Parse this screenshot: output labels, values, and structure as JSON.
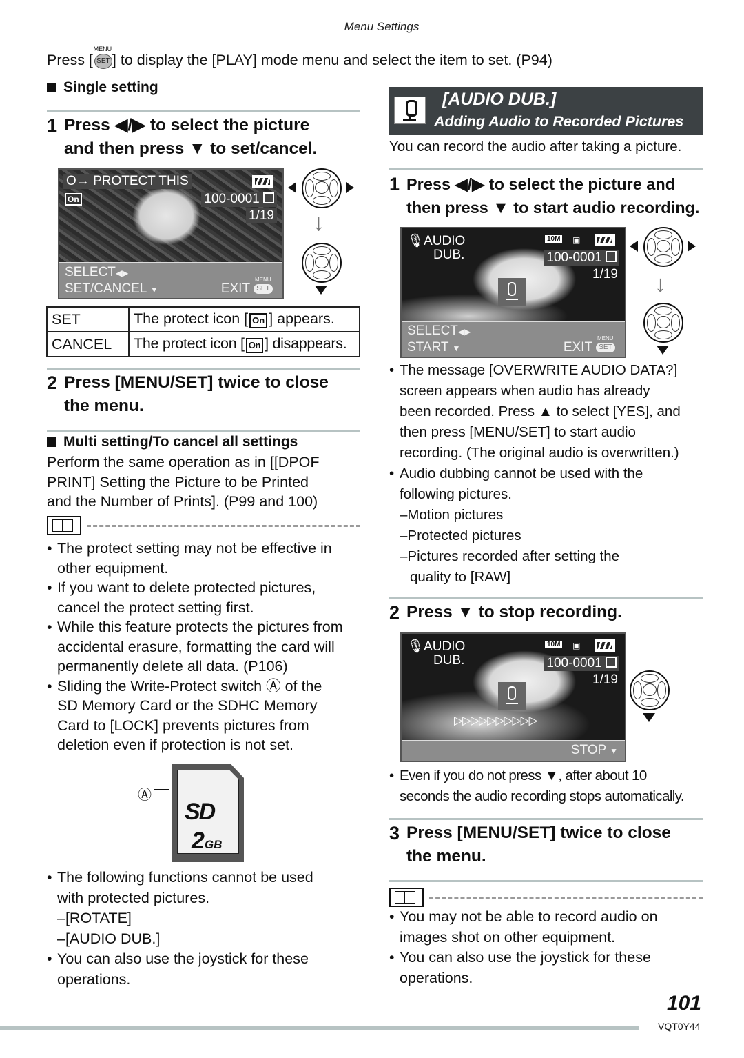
{
  "page": {
    "header": "Menu Settings",
    "page_number": "101",
    "doc_code": "VQT0Y44"
  },
  "intro": {
    "before": "Press [",
    "menu_icon_top": "MENU",
    "menu_icon_label": "SET",
    "after": "] to display the [PLAY] mode menu and select the item to set. (P94)"
  },
  "left": {
    "single_setting_heading": "Single setting",
    "step1": {
      "num": "1",
      "line1": "Press ◀/▶ to select the picture",
      "line2": "and then press ▼ to set/cancel."
    },
    "screen1": {
      "title": "PROTECT THIS",
      "file_no": "100-0001",
      "count": "1/19",
      "select": "SELECT",
      "set_cancel": "SET/CANCEL",
      "exit": "EXIT",
      "menu_small": "MENU",
      "set_small": "SET"
    },
    "table": [
      {
        "key": "SET",
        "before": "The protect icon [",
        "after": "] appears."
      },
      {
        "key": "CANCEL",
        "before": "The protect icon [",
        "after": "] disappears."
      }
    ],
    "protect_icon_glyph": "On",
    "step2": {
      "num": "2",
      "line1": "Press [MENU/SET] twice to close",
      "line2": "the menu."
    },
    "multi_heading": "Multi setting/To cancel all settings",
    "multi_lines": [
      "Perform the same operation as in [[DPOF",
      "PRINT] Setting the Picture to be Printed",
      "and the Number of Prints]. (P99 and 100)"
    ],
    "notes": [
      [
        "The protect setting may not be effective in",
        "other equipment."
      ],
      [
        "If you want to delete protected pictures,",
        "cancel the protect setting first."
      ],
      [
        "While this feature protects the pictures from",
        "accidental erasure, formatting the card will",
        "permanently delete all data. (P106)"
      ],
      [
        "Sliding the Write-Protect switch Ⓐ of the",
        "SD Memory Card or the SDHC Memory",
        "Card to [LOCK] prevents pictures from",
        "deletion even if protection is not set."
      ]
    ],
    "sd_card": {
      "marker": "Ⓐ",
      "logo": "SD",
      "capacity_num": "2",
      "capacity_unit": "GB"
    },
    "notes2": [
      [
        "The following functions cannot be used",
        "with protected pictures."
      ]
    ],
    "notes2_sub": [
      "–[ROTATE]",
      "–[AUDIO DUB.]"
    ],
    "notes3": [
      [
        "You can also use the joystick for these",
        "operations."
      ]
    ]
  },
  "right": {
    "banner": {
      "title": "[AUDIO DUB.]",
      "subtitle": "Adding Audio to Recorded Pictures"
    },
    "intro": "You can record the audio after taking a picture.",
    "step1": {
      "num": "1",
      "line1": "Press ◀/▶ to select the picture and",
      "line2": "then press ▼ to start audio recording."
    },
    "screen2": {
      "title1": "AUDIO",
      "title2": "DUB.",
      "quality": "10M",
      "file_no": "100-0001",
      "count": "1/19",
      "select": "SELECT",
      "start": "START",
      "exit": "EXIT",
      "menu_small": "MENU",
      "set_small": "SET"
    },
    "notes_a": [
      [
        "The message [OVERWRITE AUDIO DATA?]",
        "screen appears when audio has already",
        "been recorded. Press ▲ to select [YES], and",
        "then press [MENU/SET] to start audio",
        "recording. (The original audio is overwritten.)"
      ],
      [
        "Audio dubbing cannot be used with the",
        "following pictures."
      ]
    ],
    "notes_a_sub": [
      "–Motion pictures",
      "–Protected pictures",
      "–Pictures recorded after setting the"
    ],
    "notes_a_sub_cont": "quality to [RAW]",
    "step2": {
      "num": "2",
      "line1": "Press ▼ to stop recording."
    },
    "screen3": {
      "title1": "AUDIO",
      "title2": "DUB.",
      "quality": "10M",
      "file_no": "100-0001",
      "count": "1/19",
      "progress_arrows": "▷▷▷▷▷▷▷▷▷▷",
      "stop": "STOP"
    },
    "note_b": [
      "Even if you do not press ▼, after about 10",
      "seconds the audio recording stops automatically."
    ],
    "step3": {
      "num": "3",
      "line1": "Press [MENU/SET] twice to close",
      "line2": "the menu."
    },
    "notes_c": [
      [
        "You may not be able to record audio on",
        "images shot on other equipment."
      ],
      [
        "You can also use the joystick for these",
        "operations."
      ]
    ]
  }
}
